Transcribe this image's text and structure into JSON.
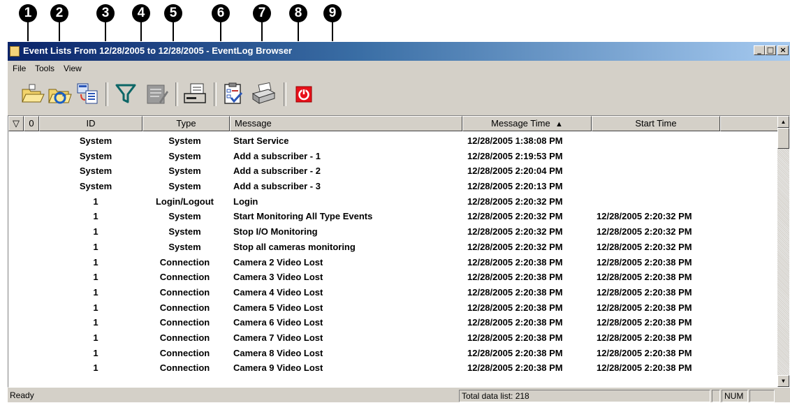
{
  "callouts": [
    "1",
    "2",
    "3",
    "4",
    "5",
    "6",
    "7",
    "8",
    "9"
  ],
  "window": {
    "title": "Event Lists From 12/28/2005 to 12/28/2005 - EventLog Browser",
    "minimize": "_",
    "maximize": "□",
    "close": "×"
  },
  "menu": [
    "File",
    "Tools",
    "View"
  ],
  "toolbar": [
    {
      "name": "open-icon",
      "label": "Open"
    },
    {
      "name": "refresh-icon",
      "label": "Refresh"
    },
    {
      "name": "copy-list-icon",
      "label": "Copy"
    },
    {
      "name": "filter-icon",
      "label": "Filter"
    },
    {
      "name": "note-icon",
      "label": "Note"
    },
    {
      "name": "export-icon",
      "label": "Export"
    },
    {
      "name": "checklist-icon",
      "label": "Report"
    },
    {
      "name": "print-icon",
      "label": "Print"
    },
    {
      "name": "power-icon",
      "label": "Exit"
    }
  ],
  "columns": {
    "filter": "▽",
    "attach": "0",
    "id": "ID",
    "type": "Type",
    "message": "Message",
    "message_time": "Message Time",
    "sort_arrow": "▲",
    "start_time": "Start Time"
  },
  "rows": [
    {
      "id": "System",
      "type": "System",
      "message": "Start Service",
      "message_time": "12/28/2005 1:38:08 PM",
      "start_time": ""
    },
    {
      "id": "System",
      "type": "System",
      "message": "Add a subscriber - 1",
      "message_time": "12/28/2005 2:19:53 PM",
      "start_time": ""
    },
    {
      "id": "System",
      "type": "System",
      "message": "Add a subscriber - 2",
      "message_time": "12/28/2005 2:20:04 PM",
      "start_time": ""
    },
    {
      "id": "System",
      "type": "System",
      "message": "Add a subscriber - 3",
      "message_time": "12/28/2005 2:20:13 PM",
      "start_time": ""
    },
    {
      "id": "1",
      "type": "Login/Logout",
      "message": "Login",
      "message_time": "12/28/2005 2:20:32 PM",
      "start_time": ""
    },
    {
      "id": "1",
      "type": "System",
      "message": "Start Monitoring All Type Events",
      "message_time": "12/28/2005 2:20:32 PM",
      "start_time": "12/28/2005 2:20:32 PM"
    },
    {
      "id": "1",
      "type": "System",
      "message": "Stop I/O Monitoring",
      "message_time": "12/28/2005 2:20:32 PM",
      "start_time": "12/28/2005 2:20:32 PM"
    },
    {
      "id": "1",
      "type": "System",
      "message": "Stop all cameras monitoring",
      "message_time": "12/28/2005 2:20:32 PM",
      "start_time": "12/28/2005 2:20:32 PM"
    },
    {
      "id": "1",
      "type": "Connection",
      "message": "Camera 2 Video Lost",
      "message_time": "12/28/2005 2:20:38 PM",
      "start_time": "12/28/2005 2:20:38 PM"
    },
    {
      "id": "1",
      "type": "Connection",
      "message": "Camera 3 Video Lost",
      "message_time": "12/28/2005 2:20:38 PM",
      "start_time": "12/28/2005 2:20:38 PM"
    },
    {
      "id": "1",
      "type": "Connection",
      "message": "Camera 4 Video Lost",
      "message_time": "12/28/2005 2:20:38 PM",
      "start_time": "12/28/2005 2:20:38 PM"
    },
    {
      "id": "1",
      "type": "Connection",
      "message": "Camera 5 Video Lost",
      "message_time": "12/28/2005 2:20:38 PM",
      "start_time": "12/28/2005 2:20:38 PM"
    },
    {
      "id": "1",
      "type": "Connection",
      "message": "Camera 6 Video Lost",
      "message_time": "12/28/2005 2:20:38 PM",
      "start_time": "12/28/2005 2:20:38 PM"
    },
    {
      "id": "1",
      "type": "Connection",
      "message": "Camera 7 Video Lost",
      "message_time": "12/28/2005 2:20:38 PM",
      "start_time": "12/28/2005 2:20:38 PM"
    },
    {
      "id": "1",
      "type": "Connection",
      "message": "Camera 8 Video Lost",
      "message_time": "12/28/2005 2:20:38 PM",
      "start_time": "12/28/2005 2:20:38 PM"
    },
    {
      "id": "1",
      "type": "Connection",
      "message": "Camera 9 Video Lost",
      "message_time": "12/28/2005 2:20:38 PM",
      "start_time": "12/28/2005 2:20:38 PM"
    }
  ],
  "status": {
    "left": "Ready",
    "total": "Total data list: 218",
    "num": "NUM"
  },
  "colors": {
    "title_start": "#0a246a",
    "title_end": "#a6caf0",
    "chrome": "#d4d0c8",
    "power_red": "#e8101a"
  }
}
